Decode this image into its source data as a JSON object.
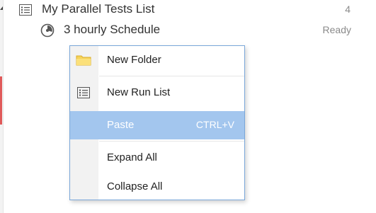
{
  "tree": {
    "list_item": {
      "label": "My Parallel Tests List",
      "count": "4",
      "icon": "list-icon"
    },
    "schedule_item": {
      "label": "3 hourly Schedule",
      "status": "Ready",
      "icon": "schedule-icon"
    }
  },
  "context_menu": {
    "items": [
      {
        "label": "New Folder",
        "icon": "folder-icon"
      },
      {
        "label": "New Run List",
        "icon": "list-icon"
      },
      {
        "label": "Paste",
        "shortcut": "CTRL+V",
        "highlighted": true
      },
      {
        "label": "Expand All"
      },
      {
        "label": "Collapse All"
      }
    ]
  },
  "colors": {
    "menu_highlight": "#a3c6ee",
    "menu_border": "#7aa7d9",
    "folder_yellow": "#f6d35a",
    "status_gray": "#8a8a8a"
  }
}
